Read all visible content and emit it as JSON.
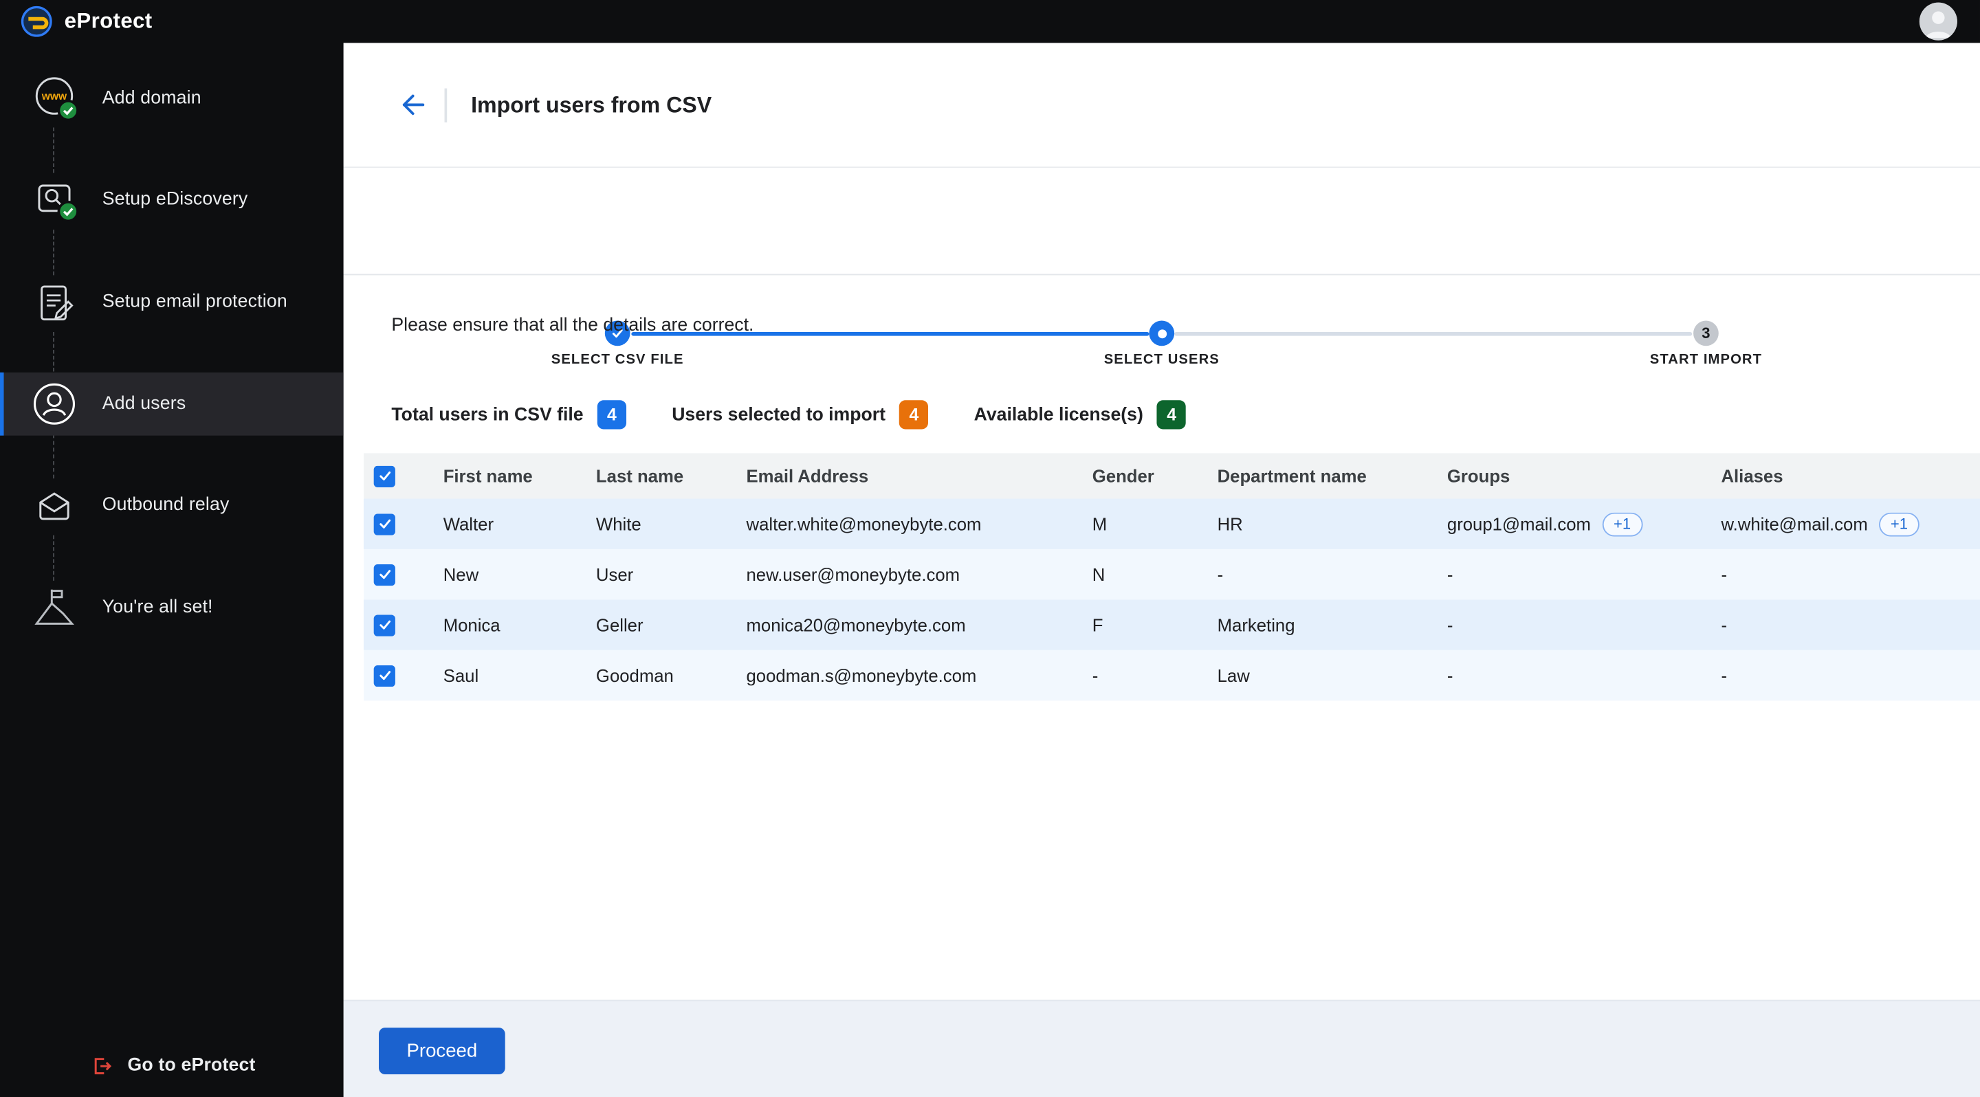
{
  "app": {
    "title": "eProtect"
  },
  "sidebar": {
    "items": [
      {
        "label": "Add domain",
        "state": "done"
      },
      {
        "label": "Setup eDiscovery",
        "state": "done"
      },
      {
        "label": "Setup email protection",
        "state": "pending"
      },
      {
        "label": "Add users",
        "state": "active"
      },
      {
        "label": "Outbound relay",
        "state": "pending"
      },
      {
        "label": "You're all set!",
        "state": "pending"
      }
    ],
    "footer_label": "Go to eProtect"
  },
  "header": {
    "title": "Import users from CSV"
  },
  "stepper": {
    "steps": [
      {
        "label": "SELECT CSV FILE",
        "state": "completed"
      },
      {
        "label": "SELECT USERS",
        "state": "active"
      },
      {
        "label": "START IMPORT",
        "state": "upcoming",
        "number": "3"
      }
    ]
  },
  "content": {
    "note": "Please ensure that all the details are correct.",
    "stats": [
      {
        "label": "Total users in CSV file",
        "value": "4",
        "color": "#1a73e8"
      },
      {
        "label": "Users selected to import",
        "value": "4",
        "color": "#e8710a"
      },
      {
        "label": "Available license(s)",
        "value": "4",
        "color": "#0d652d"
      }
    ],
    "table": {
      "columns": [
        "First name",
        "Last name",
        "Email Address",
        "Gender",
        "Department name",
        "Groups",
        "Aliases"
      ],
      "rows": [
        {
          "first": "Walter",
          "last": "White",
          "email": "walter.white@moneybyte.com",
          "gender": "M",
          "department": "HR",
          "groups": "group1@mail.com",
          "groups_extra": "+1",
          "aliases": "w.white@mail.com",
          "aliases_extra": "+1",
          "checked": true
        },
        {
          "first": "New",
          "last": "User",
          "email": "new.user@moneybyte.com",
          "gender": "N",
          "department": "-",
          "groups": "-",
          "aliases": "-",
          "checked": true
        },
        {
          "first": "Monica",
          "last": "Geller",
          "email": "monica20@moneybyte.com",
          "gender": "F",
          "department": "Marketing",
          "groups": "-",
          "aliases": "-",
          "checked": true
        },
        {
          "first": "Saul",
          "last": "Goodman",
          "email": "goodman.s@moneybyte.com",
          "gender": "-",
          "department": "Law",
          "groups": "-",
          "aliases": "-",
          "checked": true
        }
      ]
    },
    "proceed_label": "Proceed"
  }
}
